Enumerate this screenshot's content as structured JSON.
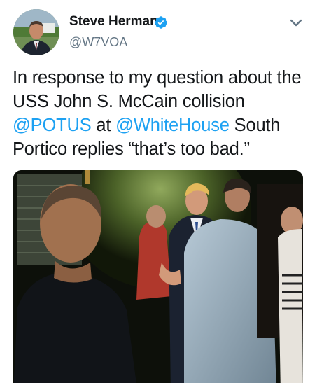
{
  "tweet": {
    "author": {
      "display_name": "Steve Herman",
      "handle": "@W7VOA",
      "verified": true,
      "verified_icon": "verified-badge-icon",
      "verified_color": "#1da1f2"
    },
    "menu_icon": "chevron-down-icon",
    "text": {
      "part1": "In response to my question about the USS John S. McCain collision ",
      "mention1": "@POTUS",
      "part2": " at ",
      "mention2": "@WhiteHouse",
      "part3": " South Portico replies “that’s too bad.”"
    },
    "colors": {
      "link": "#1da1f2",
      "text": "#14171a",
      "secondary": "#657786"
    }
  }
}
